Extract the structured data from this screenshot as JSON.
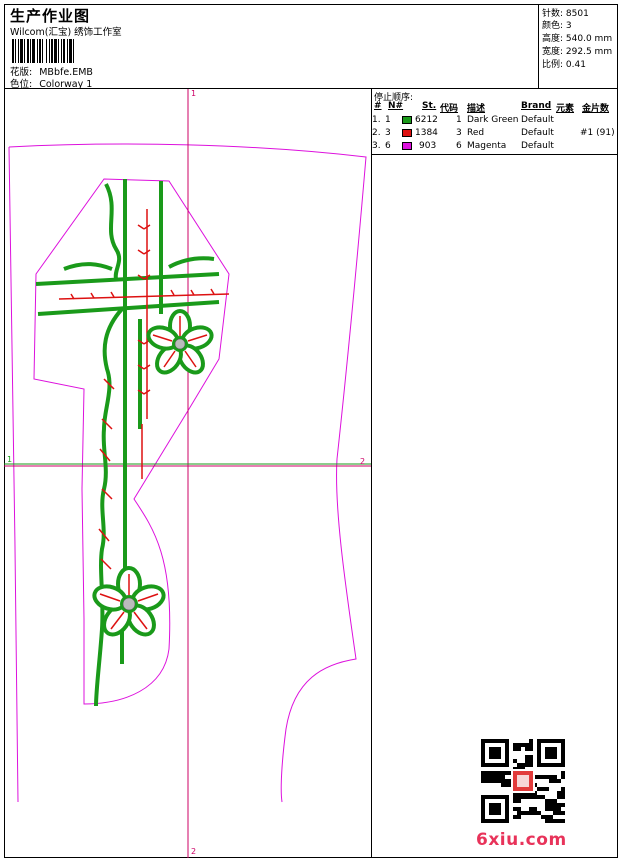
{
  "header": {
    "title": "生产作业图",
    "subtitle": "Wilcom(汇宝) 绣饰工作室",
    "design_label": "花版:",
    "design_file": "MBbfe.EMB",
    "colorway_label": "色位:",
    "colorway": "Colorway 1"
  },
  "stats": [
    {
      "label": "针数:",
      "value": "8501"
    },
    {
      "label": "颜色:",
      "value": "3"
    },
    {
      "label": "高度:",
      "value": "540.0 mm"
    },
    {
      "label": "宽度:",
      "value": "292.5 mm"
    },
    {
      "label": "比例:",
      "value": "0.41"
    }
  ],
  "stop_sequence": {
    "title": "停止顺序:",
    "columns": [
      "#",
      "N#",
      "St.",
      "代码",
      "描述",
      "Brand",
      "元素",
      "金片数"
    ],
    "rows": [
      {
        "num": "1.",
        "n": "1",
        "swatch": "#1a9a1a",
        "st": "6212",
        "code": "1",
        "desc": "Dark Green",
        "brand": "Default",
        "element": "",
        "sequins": ""
      },
      {
        "num": "2.",
        "n": "3",
        "swatch": "#dd1111",
        "st": "1384",
        "code": "3",
        "desc": "Red",
        "brand": "Default",
        "element": "",
        "sequins": "#1 (91)"
      },
      {
        "num": "3.",
        "n": "6",
        "swatch": "#dd11dd",
        "st": "903",
        "code": "6",
        "desc": "Magenta",
        "brand": "Default",
        "element": "",
        "sequins": ""
      }
    ]
  },
  "guides": {
    "v_top": "1",
    "v_bottom": "2",
    "h_left": "1",
    "h_right": "2"
  },
  "colors": {
    "green": "#1a9a1a",
    "red": "#dd1111",
    "magenta": "#dd11dd",
    "guide": "#cc0066",
    "guide_h": "#1a9a1a"
  },
  "watermark": "6xiu.com"
}
